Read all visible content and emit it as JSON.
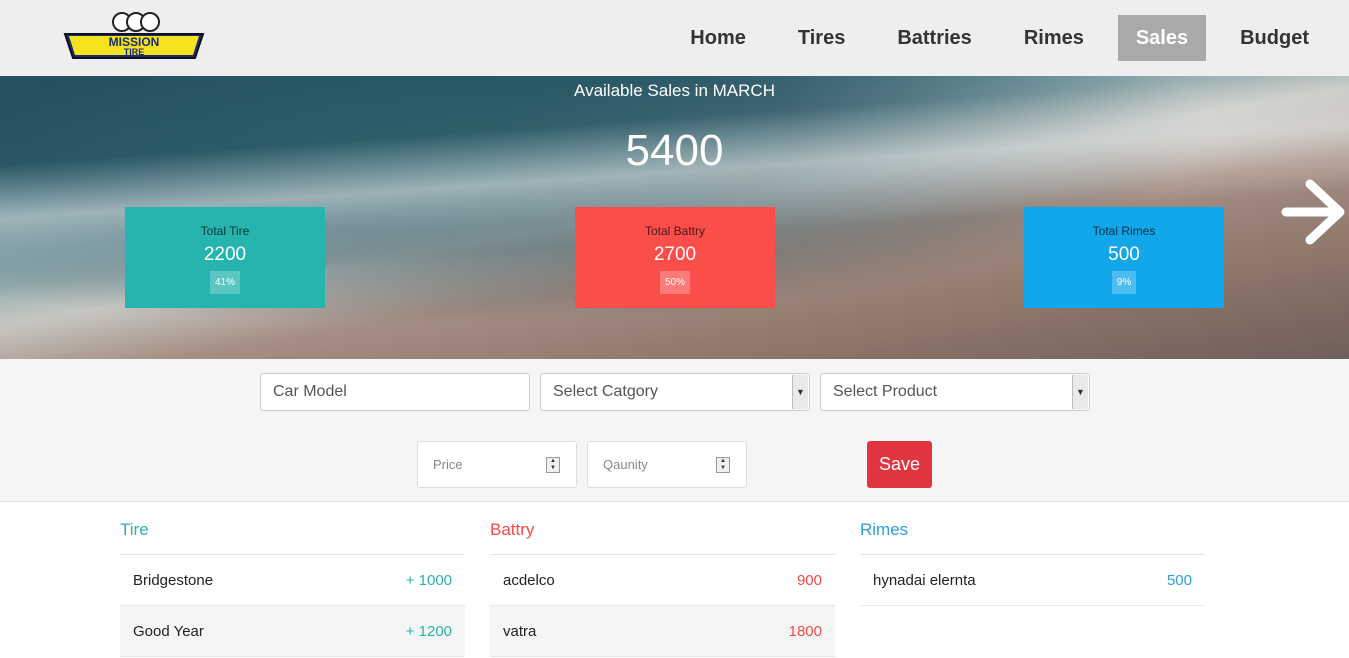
{
  "navbar": {
    "logo_text": [
      "MISSION",
      "TIRE"
    ],
    "items": [
      "Home",
      "Tires",
      "Battries",
      "Rimes",
      "Sales",
      "Budget"
    ],
    "active": "Sales"
  },
  "hero": {
    "title": "Available Sales in MARCH",
    "total": "5400",
    "cards": [
      {
        "label": "Total Tire",
        "value": "2200",
        "percent": "41%",
        "color": "#26b5ae"
      },
      {
        "label": "Total Battry",
        "value": "2700",
        "percent": "50%",
        "color": "#fb4e4a"
      },
      {
        "label": "Total Rimes",
        "value": "500",
        "percent": "9%",
        "color": "#12a7ea"
      }
    ],
    "next_icon": "arrow-right-icon"
  },
  "form": {
    "car_model_placeholder": "Car Model",
    "category_placeholder": "Select Catgory",
    "product_placeholder": "Select Product",
    "price_placeholder": "Price",
    "quantity_placeholder": "Qaunity",
    "save_label": "Save"
  },
  "lists": {
    "tire": {
      "title": "Tire",
      "rows": [
        {
          "name": "Bridgestone",
          "value": "+ 1000"
        },
        {
          "name": "Good Year",
          "value": "+ 1200"
        }
      ]
    },
    "battery": {
      "title": "Battry",
      "rows": [
        {
          "name": "acdelco",
          "value": "900"
        },
        {
          "name": "vatra",
          "value": "1800"
        }
      ]
    },
    "rimes": {
      "title": "Rimes",
      "rows": [
        {
          "name": "hynadai elernta",
          "value": "500"
        }
      ]
    }
  },
  "colors": {
    "tire": "#26b5ae",
    "battery": "#fb4e4a",
    "rimes": "#12a7ea",
    "save": "#e0353f"
  }
}
